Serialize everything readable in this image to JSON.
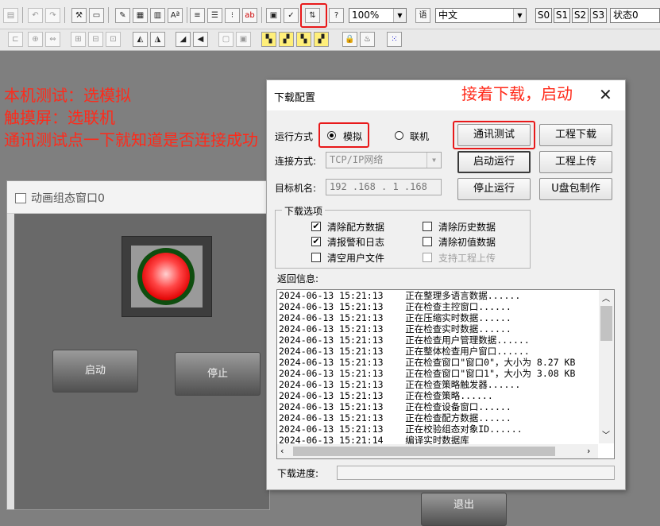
{
  "toolbar": {
    "zoom_value": "100%",
    "language_value": "中文",
    "state_buttons": [
      "S0",
      "S1",
      "S2",
      "S3"
    ],
    "status_value": "状态0"
  },
  "annotations": {
    "lines_left": [
      "本机测试：选模拟",
      "触摸屏：选联机",
      "通讯测试点一下就知道是否连接成功"
    ],
    "dialog_note": "接着下载，启动"
  },
  "colors": {
    "annotation": "#ff2a1a",
    "highlight_box": "#e8191a"
  },
  "background_window": {
    "title": "动画组态窗口0",
    "buttons": {
      "start": "启动",
      "stop": "停止",
      "exit": "退出"
    }
  },
  "dialog": {
    "title": "下载配置",
    "run_mode_label": "运行方式",
    "run_mode_options": [
      "模拟",
      "联机"
    ],
    "run_mode_selected": "模拟",
    "connection_label": "连接方式:",
    "connection_value": "TCP/IP网络",
    "target_label": "目标机名:",
    "target_ip": "192 .168 . 1  .168",
    "buttons": {
      "comm_test": "通讯测试",
      "project_download": "工程下载",
      "start_run": "启动运行",
      "project_upload": "工程上传",
      "stop_run": "停止运行",
      "usb_make": "U盘包制作"
    },
    "options_group": {
      "label": "下载选项",
      "items": [
        {
          "label": "清除配方数据",
          "checked": true,
          "enabled": true
        },
        {
          "label": "清除历史数据",
          "checked": false,
          "enabled": true
        },
        {
          "label": "清报警和日志",
          "checked": true,
          "enabled": true
        },
        {
          "label": "清除初值数据",
          "checked": false,
          "enabled": true
        },
        {
          "label": "清空用户文件",
          "checked": false,
          "enabled": true
        },
        {
          "label": "支持工程上传",
          "checked": false,
          "enabled": false
        }
      ]
    },
    "log_label": "返回信息:",
    "log_lines": [
      "2024-06-13 15:21:13    正在整理多语言数据......",
      "2024-06-13 15:21:13    正在检查主控窗口......",
      "2024-06-13 15:21:13    正在压缩实时数据......",
      "2024-06-13 15:21:13    正在检查实时数据......",
      "2024-06-13 15:21:13    正在检查用户管理数据......",
      "2024-06-13 15:21:13    正在整体检查用户窗口......",
      "2024-06-13 15:21:13    正在检查窗口\"窗口0\"，大小为 8.27 KB",
      "2024-06-13 15:21:13    正在检查窗口\"窗口1\"，大小为 3.08 KB",
      "2024-06-13 15:21:13    正在检查策略触发器......",
      "2024-06-13 15:21:13    正在检查策略......",
      "2024-06-13 15:21:13    正在检查设备窗口......",
      "2024-06-13 15:21:13    正在检查配方数据......",
      "2024-06-13 15:21:13    正在校验组态对象ID......",
      "2024-06-13 15:21:14    编译实时数据库"
    ],
    "progress_label": "下载进度:",
    "progress_value": 0
  }
}
